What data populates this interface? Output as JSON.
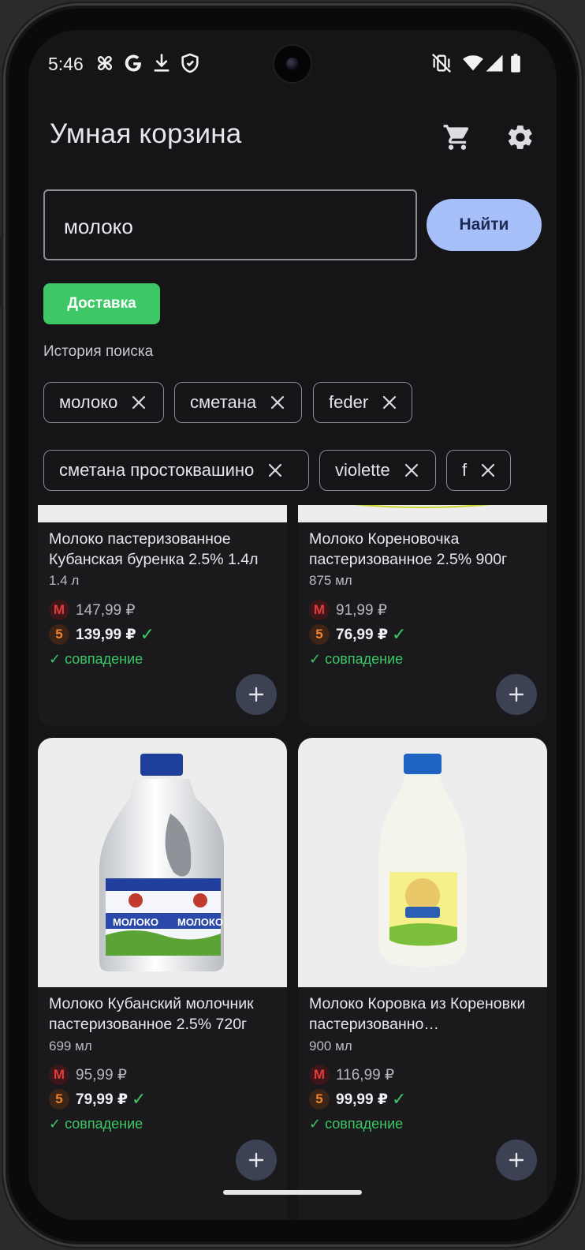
{
  "status": {
    "time": "5:46",
    "left_icons": [
      "pinwheel-icon",
      "google-icon",
      "download-icon",
      "shield-icon"
    ],
    "right_icons": [
      "vibrate-off-icon",
      "wifi-icon",
      "signal-icon",
      "battery-icon"
    ]
  },
  "app": {
    "title": "Умная корзина",
    "cart_icon": "cart-icon",
    "settings_icon": "gear-icon"
  },
  "search": {
    "value": "молоко",
    "button_label": "Найти"
  },
  "delivery_label": "Доставка",
  "history": {
    "label": "История поиска",
    "chips": [
      "молоко",
      "сметана",
      "feder",
      "сметана простоквашино",
      "violette",
      "f"
    ]
  },
  "products": [
    {
      "name": "Молоко пастеризованное Кубанская буренка 2.5% 1.4л",
      "volume": "1.4 л",
      "price_m": "147,99 ₽",
      "price_5": "139,99 ₽",
      "match": "✓ совпадение"
    },
    {
      "name": "Молоко Кореновочка пастеризованное 2.5% 900г",
      "volume": "875 мл",
      "price_m": "91,99 ₽",
      "price_5": "76,99 ₽",
      "match": "✓ совпадение"
    },
    {
      "name": "Молоко Кубанский молочник пастеризованное 2.5% 720г",
      "volume": "699 мл",
      "price_m": "95,99 ₽",
      "price_5": "79,99 ₽",
      "match": "✓ совпадение"
    },
    {
      "name": "Молоко Коровка из Кореновки пастеризованно…",
      "volume": "900 мл",
      "price_m": "116,99 ₽",
      "price_5": "99,99 ₽",
      "match": "✓ совпадение"
    }
  ],
  "store_badges": {
    "m": "М",
    "five": "5"
  },
  "labels_on_pack": {
    "brand": "МОЛОКО"
  },
  "colors": {
    "accent_green": "#3dc766",
    "find_button": "#a6bff8",
    "badge_m": "#e43b3b",
    "badge_5": "#f0842c",
    "background": "#151517"
  }
}
